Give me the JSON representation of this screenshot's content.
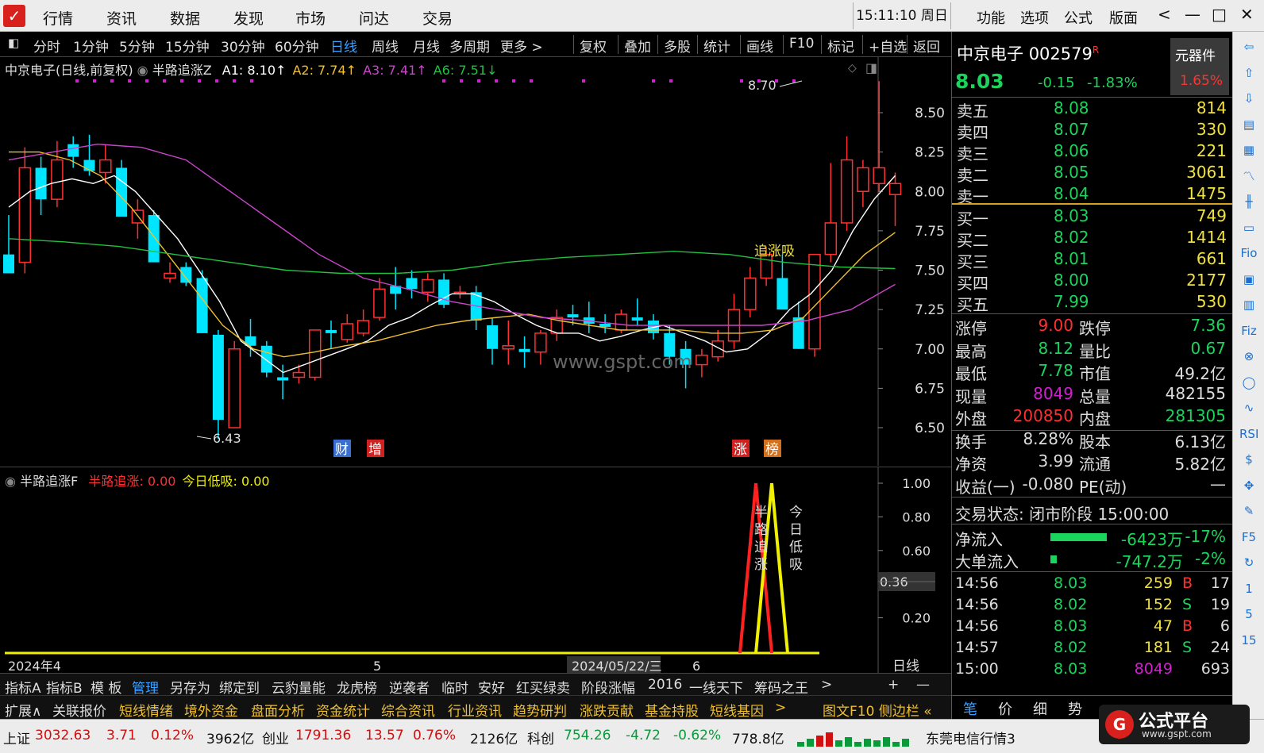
{
  "app": {
    "logo": "logo-icon"
  },
  "menu": [
    "行情",
    "资讯",
    "数据",
    "发现",
    "市场",
    "问达",
    "交易"
  ],
  "clock": "15:11:10 周日",
  "right_menu": [
    "功能",
    "选项",
    "公式",
    "版面"
  ],
  "window_buttons": {
    "back": "<",
    "minimize": "—",
    "maximize": "□",
    "close": "✕"
  },
  "toolbar": {
    "left": [
      "分时",
      "1分钟",
      "5分钟",
      "15分钟",
      "30分钟",
      "60分钟",
      "日线",
      "周线",
      "月线",
      "多周期",
      "更多 >"
    ],
    "right": [
      "复权",
      "叠加",
      "多股",
      "统计",
      "画线",
      "F10",
      "标记",
      "+自选",
      "返回"
    ],
    "active": "日线"
  },
  "chart": {
    "title": "中京电子(日线,前复权)",
    "indicator": "半路追涨Z",
    "ma": [
      {
        "label": "A1: 8.10↑",
        "color": "#ffffff"
      },
      {
        "label": "A2: 7.74↑",
        "color": "#f0c030"
      },
      {
        "label": "A3: 7.41↑",
        "color": "#cc44cc"
      },
      {
        "label": "A6: 7.51↓",
        "color": "#22c040"
      }
    ],
    "yticks": [
      "8.50",
      "8.25",
      "8.00",
      "7.75",
      "7.50",
      "7.25",
      "7.00",
      "6.75",
      "6.50"
    ],
    "high_label": "8.70",
    "low_label": "6.43",
    "watermark": "www.gspt.com",
    "signal_label": "追涨吸",
    "markers": [
      "财",
      "增",
      "涨",
      "榜"
    ],
    "colors": {
      "up": "#ff3030",
      "down": "#00e5ff",
      "bg": "#000000"
    }
  },
  "chart_data": {
    "type": "candlestick",
    "y_range": [
      6.43,
      8.7
    ],
    "candles": [
      {
        "o": 7.6,
        "h": 7.85,
        "l": 7.48,
        "c": 7.48,
        "dir": "down"
      },
      {
        "o": 7.55,
        "h": 8.28,
        "l": 7.48,
        "c": 8.15,
        "dir": "up"
      },
      {
        "o": 8.15,
        "h": 8.22,
        "l": 7.85,
        "c": 7.95,
        "dir": "down"
      },
      {
        "o": 7.95,
        "h": 8.32,
        "l": 7.9,
        "c": 8.2,
        "dir": "up"
      },
      {
        "o": 8.3,
        "h": 8.35,
        "l": 8.15,
        "c": 8.22,
        "dir": "down"
      },
      {
        "o": 8.2,
        "h": 8.36,
        "l": 8.1,
        "c": 8.13,
        "dir": "down"
      },
      {
        "o": 8.12,
        "h": 8.3,
        "l": 8.05,
        "c": 8.2,
        "dir": "up"
      },
      {
        "o": 8.15,
        "h": 8.2,
        "l": 7.84,
        "c": 7.84,
        "dir": "down"
      },
      {
        "o": 7.8,
        "h": 7.95,
        "l": 7.7,
        "c": 7.88,
        "dir": "up"
      },
      {
        "o": 7.85,
        "h": 7.88,
        "l": 7.55,
        "c": 7.55,
        "dir": "down"
      },
      {
        "o": 7.48,
        "h": 7.55,
        "l": 7.42,
        "c": 7.45,
        "dir": "up"
      },
      {
        "o": 7.52,
        "h": 7.55,
        "l": 7.4,
        "c": 7.42,
        "dir": "down"
      },
      {
        "o": 7.45,
        "h": 7.5,
        "l": 7.1,
        "c": 7.1,
        "dir": "down"
      },
      {
        "o": 7.09,
        "h": 7.12,
        "l": 6.43,
        "c": 6.55,
        "dir": "down"
      },
      {
        "o": 6.5,
        "h": 7.05,
        "l": 6.5,
        "c": 7.0,
        "dir": "up"
      },
      {
        "o": 7.08,
        "h": 7.19,
        "l": 6.95,
        "c": 7.02,
        "dir": "down"
      },
      {
        "o": 7.02,
        "h": 7.05,
        "l": 6.82,
        "c": 6.85,
        "dir": "down"
      },
      {
        "o": 6.8,
        "h": 6.9,
        "l": 6.68,
        "c": 6.82,
        "dir": "down"
      },
      {
        "o": 6.82,
        "h": 6.9,
        "l": 6.78,
        "c": 6.85,
        "dir": "up"
      },
      {
        "o": 6.82,
        "h": 7.12,
        "l": 6.8,
        "c": 7.12,
        "dir": "up"
      },
      {
        "o": 7.1,
        "h": 7.18,
        "l": 7.0,
        "c": 7.12,
        "dir": "down"
      },
      {
        "o": 7.06,
        "h": 7.22,
        "l": 7.04,
        "c": 7.16,
        "dir": "up"
      },
      {
        "o": 7.1,
        "h": 7.25,
        "l": 7.08,
        "c": 7.18,
        "dir": "up"
      },
      {
        "o": 7.2,
        "h": 7.45,
        "l": 7.18,
        "c": 7.38,
        "dir": "up"
      },
      {
        "o": 7.4,
        "h": 7.52,
        "l": 7.25,
        "c": 7.35,
        "dir": "down"
      },
      {
        "o": 7.38,
        "h": 7.5,
        "l": 7.32,
        "c": 7.45,
        "dir": "down"
      },
      {
        "o": 7.36,
        "h": 7.48,
        "l": 7.3,
        "c": 7.44,
        "dir": "up"
      },
      {
        "o": 7.44,
        "h": 7.48,
        "l": 7.26,
        "c": 7.28,
        "dir": "down"
      },
      {
        "o": 7.35,
        "h": 7.4,
        "l": 7.32,
        "c": 7.36,
        "dir": "up"
      },
      {
        "o": 7.36,
        "h": 7.4,
        "l": 7.12,
        "c": 7.18,
        "dir": "down"
      },
      {
        "o": 7.15,
        "h": 7.2,
        "l": 6.9,
        "c": 7.0,
        "dir": "down"
      },
      {
        "o": 7.02,
        "h": 7.18,
        "l": 6.9,
        "c": 7.0,
        "dir": "up"
      },
      {
        "o": 7.0,
        "h": 7.08,
        "l": 6.88,
        "c": 6.98,
        "dir": "down"
      },
      {
        "o": 6.98,
        "h": 7.12,
        "l": 6.9,
        "c": 7.1,
        "dir": "up"
      },
      {
        "o": 7.1,
        "h": 7.25,
        "l": 7.05,
        "c": 7.2,
        "dir": "up"
      },
      {
        "o": 7.2,
        "h": 7.28,
        "l": 7.15,
        "c": 7.22,
        "dir": "down"
      },
      {
        "o": 7.2,
        "h": 7.3,
        "l": 7.1,
        "c": 7.16,
        "dir": "down"
      },
      {
        "o": 7.16,
        "h": 7.22,
        "l": 7.1,
        "c": 7.14,
        "dir": "down"
      },
      {
        "o": 7.12,
        "h": 7.25,
        "l": 7.1,
        "c": 7.22,
        "dir": "up"
      },
      {
        "o": 7.2,
        "h": 7.32,
        "l": 7.15,
        "c": 7.18,
        "dir": "down"
      },
      {
        "o": 7.18,
        "h": 7.22,
        "l": 7.06,
        "c": 7.1,
        "dir": "down"
      },
      {
        "o": 7.1,
        "h": 7.15,
        "l": 6.9,
        "c": 6.95,
        "dir": "down"
      },
      {
        "o": 7.0,
        "h": 7.05,
        "l": 6.75,
        "c": 6.9,
        "dir": "down"
      },
      {
        "o": 6.9,
        "h": 7.0,
        "l": 6.82,
        "c": 6.96,
        "dir": "up"
      },
      {
        "o": 6.95,
        "h": 7.12,
        "l": 6.92,
        "c": 7.05,
        "dir": "up"
      },
      {
        "o": 7.05,
        "h": 7.35,
        "l": 7.0,
        "c": 7.25,
        "dir": "up"
      },
      {
        "o": 7.25,
        "h": 7.52,
        "l": 7.2,
        "c": 7.45,
        "dir": "up"
      },
      {
        "o": 7.45,
        "h": 7.65,
        "l": 7.4,
        "c": 7.6,
        "dir": "up"
      },
      {
        "o": 7.45,
        "h": 7.6,
        "l": 7.25,
        "c": 7.25,
        "dir": "down"
      },
      {
        "o": 7.2,
        "h": 7.3,
        "l": 7.0,
        "c": 7.0,
        "dir": "down"
      },
      {
        "o": 7.0,
        "h": 7.6,
        "l": 6.95,
        "c": 7.6,
        "dir": "up"
      },
      {
        "o": 7.6,
        "h": 8.18,
        "l": 7.55,
        "c": 7.8,
        "dir": "up"
      },
      {
        "o": 7.8,
        "h": 8.35,
        "l": 7.75,
        "c": 8.2,
        "dir": "up"
      },
      {
        "o": 8.0,
        "h": 8.2,
        "l": 7.9,
        "c": 8.15,
        "dir": "up"
      },
      {
        "o": 8.05,
        "h": 8.7,
        "l": 8.0,
        "c": 8.15,
        "dir": "up"
      },
      {
        "o": 8.05,
        "h": 8.12,
        "l": 7.78,
        "c": 7.98,
        "dir": "up"
      }
    ],
    "ma_series": {
      "A1": [
        7.9,
        8.0,
        8.05,
        8.08,
        8.05,
        8.1,
        8.0,
        7.85,
        7.7,
        7.5,
        7.3,
        7.05,
        6.95,
        6.85,
        6.9,
        6.95,
        7.0,
        7.05,
        7.15,
        7.2,
        7.28,
        7.35,
        7.35,
        7.3,
        7.22,
        7.15,
        7.1,
        7.1,
        7.05,
        7.08,
        7.12,
        7.15,
        7.1,
        7.05,
        6.98,
        7.0,
        7.1,
        7.25,
        7.35,
        7.5,
        7.75,
        7.95,
        8.1
      ],
      "A2": [
        8.25,
        8.25,
        8.2,
        8.1,
        7.9,
        7.65,
        7.4,
        7.15,
        7.0,
        6.95,
        6.98,
        7.02,
        7.05,
        7.1,
        7.15,
        7.18,
        7.2,
        7.22,
        7.18,
        7.15,
        7.12,
        7.12,
        7.12,
        7.1,
        7.1,
        7.12,
        7.2,
        7.4,
        7.6,
        7.74
      ],
      "A3": [
        8.2,
        8.25,
        8.3,
        8.28,
        8.2,
        8.0,
        7.8,
        7.6,
        7.45,
        7.38,
        7.3,
        7.25,
        7.2,
        7.18,
        7.15,
        7.15,
        7.15,
        7.15,
        7.18,
        7.25,
        7.41
      ],
      "A6": [
        7.7,
        7.68,
        7.65,
        7.6,
        7.55,
        7.5,
        7.48,
        7.48,
        7.5,
        7.55,
        7.58,
        7.6,
        7.62,
        7.6,
        7.55,
        7.52,
        7.51
      ]
    },
    "sub": {
      "yticks": [
        "1.00",
        "0.80",
        "0.60",
        "0.20"
      ],
      "current": "0.36",
      "series": [
        {
          "name": "半路追涨",
          "color": "#ff2020"
        },
        {
          "name": "今日低吸",
          "color": "#f0f000"
        }
      ]
    }
  },
  "sub": {
    "indicator": "半路追涨F",
    "vals": [
      {
        "label": "半路追涨: 0.00",
        "color": "#ff3030"
      },
      {
        "label": "今日低吸: 0.00",
        "color": "#f0f000"
      }
    ],
    "label1": "半路追涨",
    "label2": "今日低吸"
  },
  "xaxis": {
    "labels": [
      "2024年4",
      "5",
      "2024/05/22/三",
      "6"
    ],
    "period": "日线"
  },
  "quote": {
    "name": "中京电子",
    "code": "002579",
    "r": "R",
    "sector": "元器件",
    "sector_pct": "1.65%",
    "price": "8.03",
    "change": "-0.15",
    "pct": "-1.83%",
    "asks": [
      {
        "l": "卖五",
        "p": "8.08",
        "v": "814"
      },
      {
        "l": "卖四",
        "p": "8.07",
        "v": "330"
      },
      {
        "l": "卖三",
        "p": "8.06",
        "v": "221"
      },
      {
        "l": "卖二",
        "p": "8.05",
        "v": "3061"
      },
      {
        "l": "卖一",
        "p": "8.04",
        "v": "1475"
      }
    ],
    "bids": [
      {
        "l": "买一",
        "p": "8.03",
        "v": "749"
      },
      {
        "l": "买二",
        "p": "8.02",
        "v": "1414"
      },
      {
        "l": "买三",
        "p": "8.01",
        "v": "661"
      },
      {
        "l": "买四",
        "p": "8.00",
        "v": "2177"
      },
      {
        "l": "买五",
        "p": "7.99",
        "v": "530"
      }
    ],
    "stats": [
      {
        "l": "涨停",
        "v": "9.00",
        "vc": "#ff3030",
        "l2": "跌停",
        "v2": "7.36",
        "v2c": "#1bd45c"
      },
      {
        "l": "最高",
        "v": "8.12",
        "vc": "#1bd45c",
        "l2": "量比",
        "v2": "0.67",
        "v2c": "#1bd45c"
      },
      {
        "l": "最低",
        "v": "7.78",
        "vc": "#1bd45c",
        "l2": "市值",
        "v2": "49.2亿",
        "v2c": "#ddd"
      },
      {
        "l": "现量",
        "v": "8049",
        "vc": "#d020d0",
        "l2": "总量",
        "v2": "482155",
        "v2c": "#ddd"
      },
      {
        "l": "外盘",
        "v": "200850",
        "vc": "#ff3030",
        "l2": "内盘",
        "v2": "281305",
        "v2c": "#1bd45c"
      },
      {
        "l": "换手",
        "v": "8.28%",
        "vc": "#ddd",
        "l2": "股本",
        "v2": "6.13亿",
        "v2c": "#ddd"
      },
      {
        "l": "净资",
        "v": "3.99",
        "vc": "#ddd",
        "l2": "流通",
        "v2": "5.82亿",
        "v2c": "#ddd"
      },
      {
        "l": "收益(一)",
        "v": "-0.080",
        "vc": "#ddd",
        "l2": "PE(动)",
        "v2": "—",
        "v2c": "#ddd"
      }
    ],
    "trade_state": "交易状态: 闭市阶段 15:00:00",
    "flows": [
      {
        "l": "净流入",
        "v": "-6423万",
        "p": "-17%",
        "bar": 0.17
      },
      {
        "l": "大单流入",
        "v": "-747.2万",
        "p": "-2%",
        "bar": 0.02
      }
    ],
    "ticks": [
      {
        "t": "14:56",
        "p": "8.03",
        "v": "259",
        "s": "B",
        "n": "17"
      },
      {
        "t": "14:56",
        "p": "8.02",
        "v": "152",
        "s": "S",
        "n": "19"
      },
      {
        "t": "14:56",
        "p": "8.03",
        "v": "47",
        "s": "B",
        "n": "6"
      },
      {
        "t": "14:57",
        "p": "8.02",
        "v": "181",
        "s": "S",
        "n": "24"
      },
      {
        "t": "15:00",
        "p": "8.03",
        "v": "8049",
        "s": "",
        "n": "693"
      }
    ],
    "panel_tabs": [
      "笔",
      "价",
      "细",
      "势"
    ]
  },
  "bottom_tabs": [
    "指标A",
    "指标B",
    "模 板",
    "管理",
    "另存为",
    "绑定到",
    "云豹量能",
    "龙虎榜",
    "逆袭者",
    "临时",
    "安好",
    "红买绿卖",
    "阶段涨幅",
    "2016",
    "一线天下",
    "筹码之王",
    ">"
  ],
  "bottom_tabs_extra": [
    "+",
    "—"
  ],
  "bottom_tabs2": [
    "扩展∧",
    "关联报价",
    "短线情绪",
    "境外资金",
    "盘面分析",
    "资金统计",
    "综合资讯",
    "行业资讯",
    "趋势研判",
    "涨跌贡献",
    "基金持股",
    "短线基因",
    ">",
    "图文F10 侧边栏 «"
  ],
  "status": {
    "sh_label": "上证",
    "sh": "3032.63",
    "sh_chg": "3.71",
    "sh_pct": "0.12%",
    "sh_amt": "3962亿",
    "cy_label": "创业",
    "cy": "1791.36",
    "cy_chg": "13.57",
    "cy_pct": "0.76%",
    "cy_amt": "2126亿",
    "kc_label": "科创",
    "kc": "754.26",
    "kc_chg": "-4.72",
    "kc_pct": "-0.62%",
    "kc_amt": "778.8亿",
    "conn": "东莞电信行情3"
  },
  "gspt": {
    "title": "公式平台",
    "url": "www.gspt.com"
  },
  "vbar_icons": [
    "back-arrow-icon",
    "up-arrow-icon",
    "down-arrow-icon",
    "list-icon",
    "grid-icon",
    "line-chart-icon",
    "candle-icon",
    "table-icon",
    "fio-icon",
    "calc-icon",
    "doc-icon",
    "fiz-icon",
    "zoom-icon",
    "circle-icon",
    "wave-icon",
    "rsi-icon",
    "money-icon",
    "move-icon",
    "pen-icon",
    "f5-icon",
    "refresh-icon",
    "one-icon",
    "five-icon",
    "fifteen-icon"
  ],
  "vbar_labels": [
    "⇦",
    "⇧",
    "⇩",
    "▤",
    "▦",
    "〽",
    "╫",
    "▭",
    "Fio",
    "▣",
    "▥",
    "Fiz",
    "⊗",
    "◯",
    "∿",
    "RSI",
    "$",
    "✥",
    "✎",
    "F5",
    "↻",
    "1",
    "5",
    "15"
  ]
}
